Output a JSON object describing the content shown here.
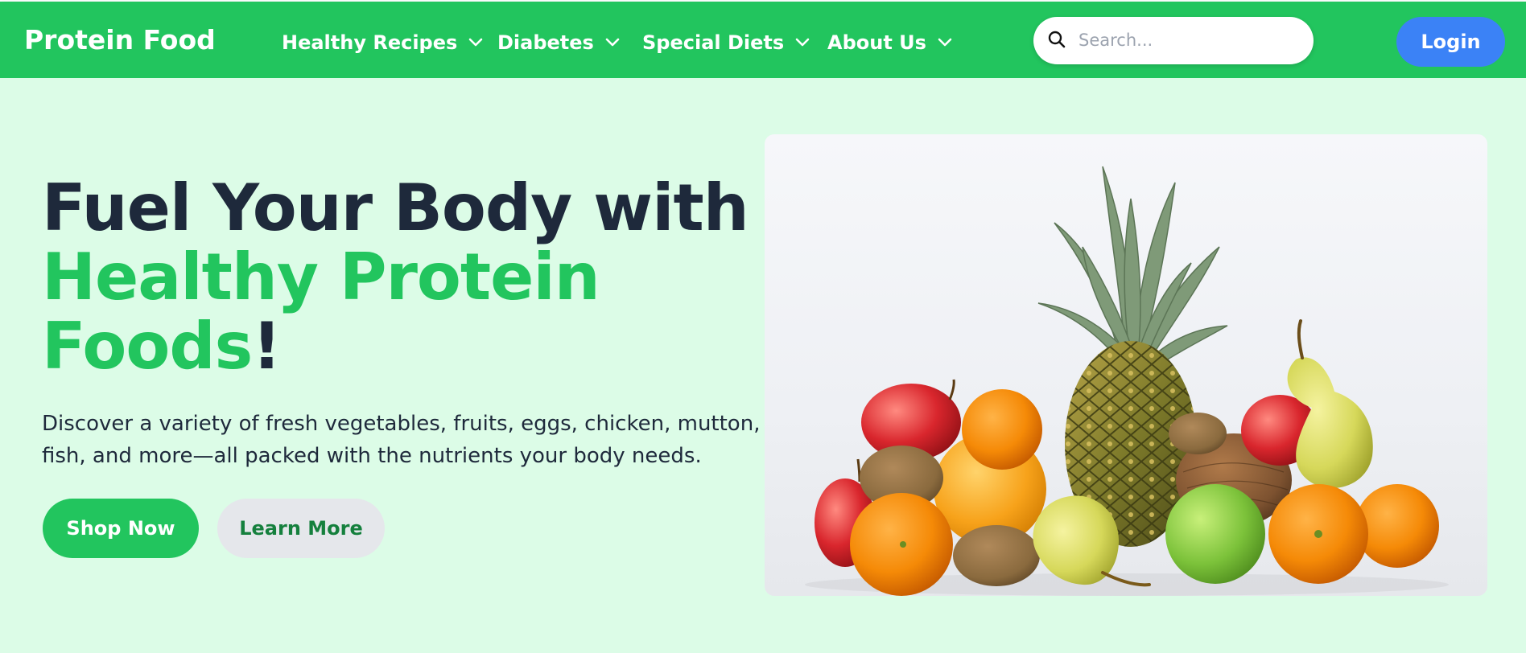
{
  "nav": {
    "brand": "Protein Food",
    "items": [
      {
        "label": "Healthy Recipes"
      },
      {
        "label": "Diabetes"
      },
      {
        "label": "Special Diets"
      },
      {
        "label": "About Us"
      }
    ],
    "search_placeholder": "Search...",
    "login_label": "Login"
  },
  "hero": {
    "headline_line1": "Fuel Your Body with",
    "headline_accent": "Healthy Protein Foods",
    "headline_end": "!",
    "description": "Discover a variety of fresh vegetables, fruits, eggs, chicken, mutton, fish, and more—all packed with the nutrients your body needs.",
    "primary_button": "Shop Now",
    "secondary_button": "Learn More"
  },
  "colors": {
    "brand_green": "#22c55e",
    "hero_background": "#dcfce7",
    "login_blue": "#3b82f6",
    "heading_dark": "#1e293b"
  },
  "icons": {
    "search": "search-icon",
    "dropdown": "chevron-down-icon"
  }
}
